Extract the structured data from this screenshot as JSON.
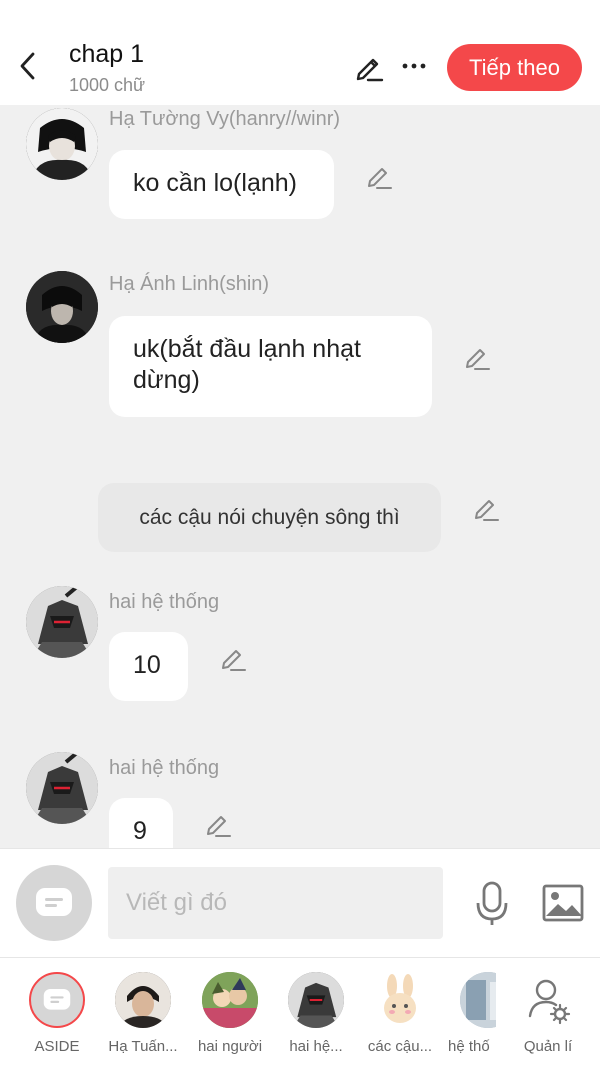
{
  "header": {
    "title": "chap 1",
    "subtitle": "1000 chữ",
    "next_label": "Tiếp theo"
  },
  "messages": [
    {
      "sender": "Hạ Tường Vy(hanry//winr)",
      "text": "ko cần lo(lạnh)"
    },
    {
      "sender": "Hạ Ánh Linh(shin)",
      "text": "uk(bắt đầu lạnh nhạt dừng)"
    },
    {
      "narration": "các cậu nói chuyện sông thì"
    },
    {
      "sender": "hai hệ thống",
      "text": "10"
    },
    {
      "sender": "hai hệ thống",
      "text": "9"
    }
  ],
  "input": {
    "placeholder": "Viết gì đó"
  },
  "characters": [
    {
      "label": "ASIDE"
    },
    {
      "label": "Hạ Tuấn..."
    },
    {
      "label": "hai người"
    },
    {
      "label": "hai hệ..."
    },
    {
      "label": "các cậu..."
    },
    {
      "label": "hệ thố"
    },
    {
      "label": "Quản lí"
    }
  ],
  "colors": {
    "accent": "#f4484a",
    "background": "#f0f0f0",
    "bubble": "#ffffff"
  }
}
